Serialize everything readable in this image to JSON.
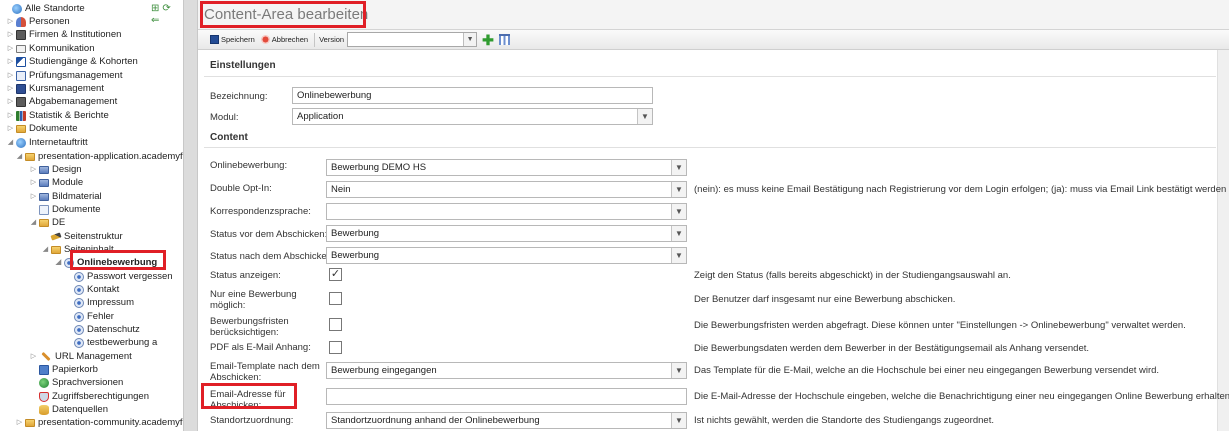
{
  "tree": {
    "items": [
      {
        "label": "Alle Standorte",
        "icon": "globe-icon"
      },
      {
        "label": "Personen",
        "icon": "people-icon"
      },
      {
        "label": "Firmen & Institutionen",
        "icon": "building-icon"
      },
      {
        "label": "Kommunikation",
        "icon": "mail-icon"
      },
      {
        "label": "Studiengänge & Kohorten",
        "icon": "graduation-icon"
      },
      {
        "label": "Prüfungsmanagement",
        "icon": "checklist-icon"
      },
      {
        "label": "Kursmanagement",
        "icon": "book-icon"
      },
      {
        "label": "Abgabemanagement",
        "icon": "inbox-icon"
      },
      {
        "label": "Statistik & Berichte",
        "icon": "chart-icon"
      },
      {
        "label": "Dokumente",
        "icon": "folder-icon"
      },
      {
        "label": "Internetauftritt",
        "icon": "globe-icon"
      },
      {
        "label": "presentation-application.academyfi",
        "icon": "folder-icon"
      },
      {
        "label": "Design",
        "icon": "folder-icon"
      },
      {
        "label": "Module",
        "icon": "folder-icon"
      },
      {
        "label": "Bildmaterial",
        "icon": "folder-icon"
      },
      {
        "label": "Dokumente",
        "icon": "document-icon"
      },
      {
        "label": "DE",
        "icon": "folder-icon"
      },
      {
        "label": "Seitenstruktur",
        "icon": "pencil-icon"
      },
      {
        "label": "Seiteninhalt",
        "icon": "folder-icon"
      },
      {
        "label": "Onlinebewerbung",
        "icon": "page-icon"
      },
      {
        "label": "Passwort vergessen",
        "icon": "page-icon"
      },
      {
        "label": "Kontakt",
        "icon": "page-icon"
      },
      {
        "label": "Impressum",
        "icon": "page-icon"
      },
      {
        "label": "Fehler",
        "icon": "page-icon"
      },
      {
        "label": "Datenschutz",
        "icon": "page-icon"
      },
      {
        "label": "testbewerbung a",
        "icon": "page-icon"
      },
      {
        "label": "URL Management",
        "icon": "wrench-icon"
      },
      {
        "label": "Papierkorb",
        "icon": "trash-icon"
      },
      {
        "label": "Sprachversionen",
        "icon": "globe-icon"
      },
      {
        "label": "Zugriffsberechtigungen",
        "icon": "shield-icon"
      },
      {
        "label": "Datenquellen",
        "icon": "database-icon"
      },
      {
        "label": "presentation-community.academyfi",
        "icon": "folder-icon"
      }
    ]
  },
  "page": {
    "title": "Content-Area bearbeiten"
  },
  "toolbar": {
    "save_label": "Speichern",
    "cancel_label": "Abbrechen",
    "version_label": "Version",
    "version_value": ""
  },
  "sections": {
    "settings": "Einstellungen",
    "content": "Content"
  },
  "settings": {
    "bezeichnung_label": "Bezeichnung:",
    "bezeichnung_value": "Onlinebewerbung",
    "modul_label": "Modul:",
    "modul_value": "Application"
  },
  "content": {
    "onlinebewerbung_label": "Onlinebewerbung:",
    "onlinebewerbung_value": "Bewerbung DEMO HS",
    "double_optin_label": "Double Opt-In:",
    "double_optin_value": "Nein",
    "double_optin_hint": "(nein): es muss keine Email Bestätigung nach Registrierung vor dem Login erfolgen; (ja): muss via Email Link bestätigt werden",
    "korrespondenz_label": "Korrespondenzsprache:",
    "korrespondenz_value": "",
    "status_vor_label": "Status vor dem Abschicken:",
    "status_vor_value": "Bewerbung",
    "status_nach_label": "Status nach dem Abschicken:",
    "status_nach_value": "Bewerbung",
    "status_anzeigen_label": "Status anzeigen:",
    "status_anzeigen_checked": true,
    "status_anzeigen_hint": "Zeigt den Status (falls bereits abgeschickt) in der Studiengangsauswahl an.",
    "nur_eine_label": "Nur eine Bewerbung möglich:",
    "nur_eine_checked": false,
    "nur_eine_hint": "Der Benutzer darf insgesamt nur eine Bewerbung abschicken.",
    "fristen_label": "Bewerbungsfristen berücksichtigen:",
    "fristen_checked": false,
    "fristen_hint": "Die Bewerbungsfristen werden abgefragt. Diese können unter \"Einstellungen -> Onlinebewerbung\" verwaltet werden.",
    "pdf_label": "PDF als E-Mail Anhang:",
    "pdf_checked": false,
    "pdf_hint": "Die Bewerbungsdaten werden dem Bewerber in der Bestätigungsemail als Anhang versendet.",
    "template_label": "Email-Template nach dem Abschicken:",
    "template_value": "Bewerbung eingegangen",
    "template_hint": "Das Template für die E-Mail, welche an die Hochschule bei einer neu eingegangen Bewerbung versendet wird.",
    "email_label": "Email-Adresse für Abschicken:",
    "email_value": "",
    "email_hint": "Die E-Mail-Adresse der Hochschule eingeben, welche die Benachrichtigung einer neu eingegangen Online Bewerbung erhalten soll.",
    "standort_label": "Standortzuordnung:",
    "standort_value": "Standortzuordnung anhand der Onlinebewerbung",
    "standort_hint": "Ist nichts gewählt, werden die Standorte des Studiengangs zugeordnet."
  },
  "colors": {
    "highlight_red": "#e01f26",
    "accent_green": "#2f9b2f"
  }
}
